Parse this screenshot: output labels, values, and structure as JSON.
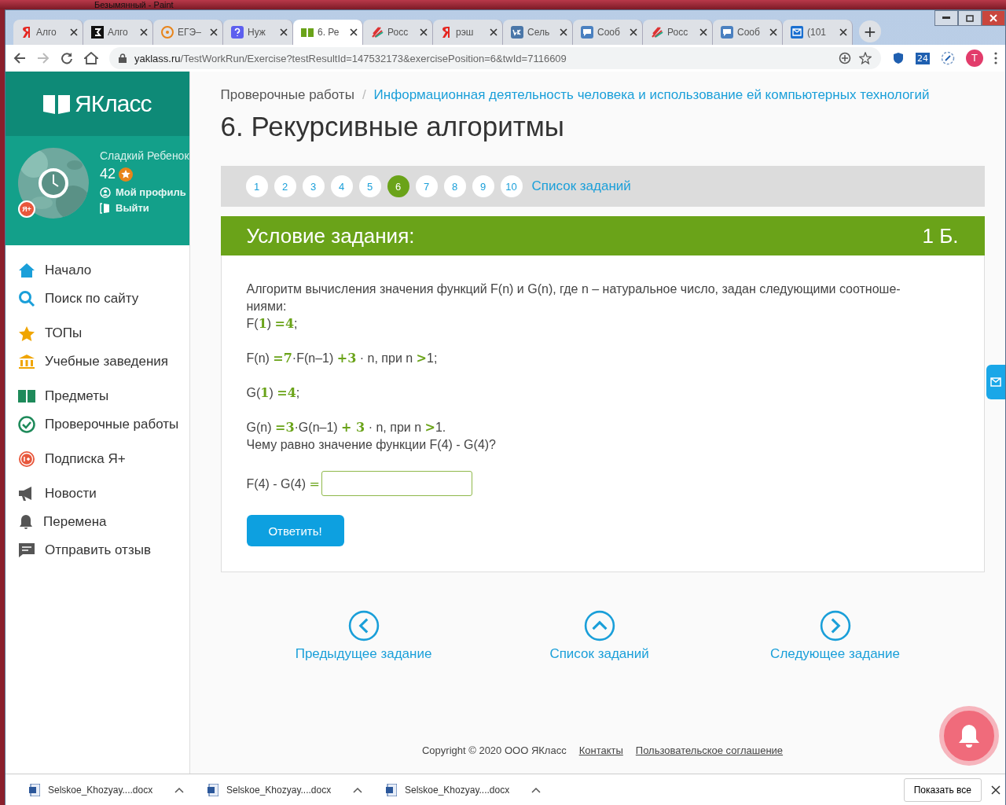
{
  "background_window": {
    "title": "Безымянный - Paint"
  },
  "browser": {
    "tabs": [
      {
        "kind": "yandex",
        "label": "Алго",
        "selected": false
      },
      {
        "kind": "znanija",
        "label": "Алго",
        "selected": false
      },
      {
        "kind": "orange",
        "label": "ЕГЭ–",
        "selected": false
      },
      {
        "kind": "question",
        "label": "Нуж",
        "selected": false
      },
      {
        "kind": "yaklass",
        "label": "6. Ре",
        "selected": true
      },
      {
        "kind": "ros",
        "label": "Росс",
        "selected": false
      },
      {
        "kind": "yandex",
        "label": "рэш",
        "selected": false
      },
      {
        "kind": "vk",
        "label": "Сель",
        "selected": false
      },
      {
        "kind": "chat",
        "label": "Сооб",
        "selected": false
      },
      {
        "kind": "ros",
        "label": "Росс",
        "selected": false
      },
      {
        "kind": "chat",
        "label": "Сооб",
        "selected": false
      },
      {
        "kind": "mail",
        "label": "(101",
        "selected": false
      }
    ],
    "new_tab": "+",
    "url_host": "yaklass.ru",
    "url_path": "/TestWorkRun/Exercise?testResultId=147532173&exercisePosition=6&twId=7116609",
    "extension_badge": "24",
    "profile_initial": "T"
  },
  "sidebar": {
    "logo": "ЯКласс",
    "user_name": "Сладкий Ребенок",
    "points": "42",
    "plus_badge": "Я+",
    "profile_link": "Мой профиль",
    "logout_link": "Выйти",
    "menu_groups": [
      [
        {
          "kind": "home",
          "label": "Начало"
        },
        {
          "kind": "search",
          "label": "Поиск по сайту"
        }
      ],
      [
        {
          "kind": "star",
          "label": "ТОПы"
        },
        {
          "kind": "bank",
          "label": "Учебные заведения"
        }
      ],
      [
        {
          "kind": "book",
          "label": "Предметы"
        },
        {
          "kind": "check",
          "label": "Проверочные работы"
        }
      ],
      [
        {
          "kind": "plus",
          "label": "Подписка Я+"
        }
      ],
      [
        {
          "kind": "megaphone",
          "label": "Новости"
        },
        {
          "kind": "bell",
          "label": "Перемена"
        },
        {
          "kind": "message",
          "label": "Отправить отзыв"
        }
      ]
    ]
  },
  "breadcrumb": [
    "Проверочные работы",
    "Информационная деятельность человека и использование ей компьютерных технологий"
  ],
  "breadcrumb_separator": "/",
  "title": "6. Рекурсивные алгоритмы",
  "pagination": {
    "pages": [
      {
        "label": "1",
        "selected": false
      },
      {
        "label": "2",
        "selected": false
      },
      {
        "label": "3",
        "selected": false
      },
      {
        "label": "4",
        "selected": false
      },
      {
        "label": "5",
        "selected": false
      },
      {
        "label": "6",
        "selected": true
      },
      {
        "label": "7",
        "selected": false
      },
      {
        "label": "8",
        "selected": false
      },
      {
        "label": "9",
        "selected": false
      },
      {
        "label": "10",
        "selected": false
      }
    ],
    "list_link": "Список заданий"
  },
  "task": {
    "header": "Условие задания:",
    "score": "1 Б.",
    "intro": "Алгоритм вычисления значения функций F(n) и G(n), где n – натуральное число, задан следующими соотноше-ниями:",
    "formulas": [
      "F(**1**) **=4**;",
      "F(n) **=7**·F(n–1) **+3** · n, при n **>**1;",
      "G(**1**) **=4**;",
      "G(n) **=3**·G(n–1) **+ 3** · n, при n **>**1."
    ],
    "question": "Чему равно значение функции F(4) - G(4)?",
    "answer_label": "F(4) - G(4) **=**",
    "submit": "Ответить!"
  },
  "navigation": [
    {
      "kind": "left",
      "label": "Предыдущее задание"
    },
    {
      "kind": "up",
      "label": "Список заданий"
    },
    {
      "kind": "right",
      "label": "Следующее задание"
    }
  ],
  "footer": {
    "copyright": "Copyright © 2020 ООО ЯКласс",
    "links": [
      "Контакты",
      "Пользовательское соглашение"
    ]
  },
  "downloads": {
    "files": [
      "Selskoe_Khozyay....docx",
      "Selskoe_Khozyay....docx",
      "Selskoe_Khozyay....docx"
    ],
    "show_all": "Показать все"
  }
}
